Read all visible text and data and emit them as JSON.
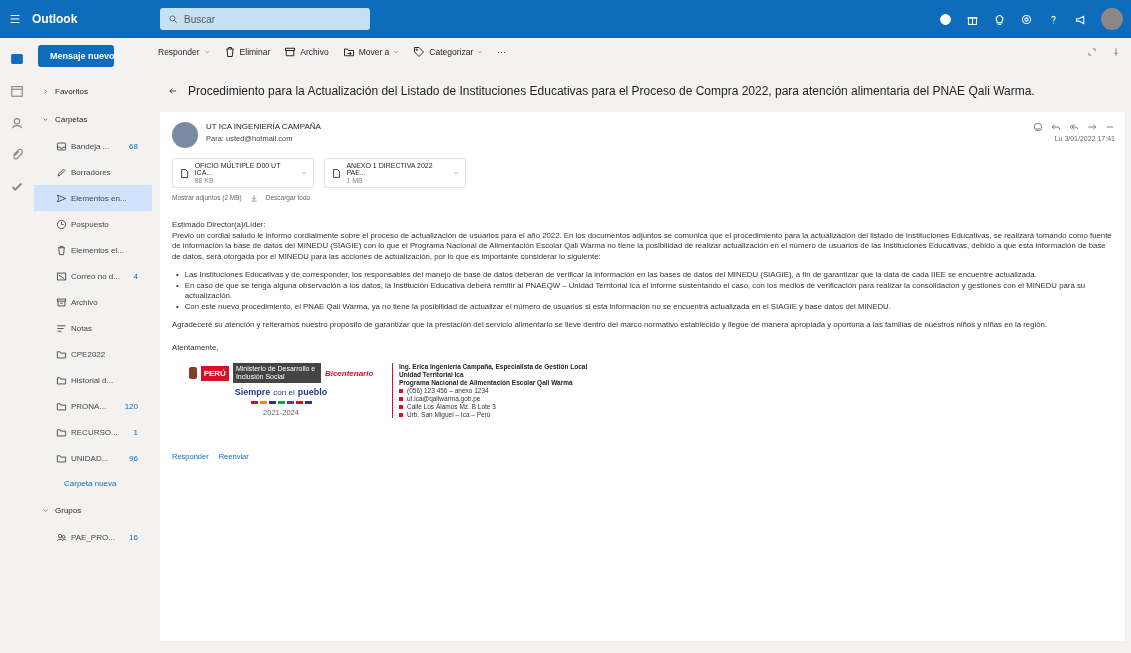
{
  "app": {
    "name": "Outlook",
    "search_placeholder": "Buscar"
  },
  "rail": [
    {
      "kind": "mail",
      "selected": true
    },
    {
      "kind": "calendar",
      "selected": false
    },
    {
      "kind": "people",
      "selected": false
    },
    {
      "kind": "clip",
      "selected": false
    },
    {
      "kind": "todo",
      "selected": false
    }
  ],
  "toolbar": {
    "new_message": "Mensaje nuevo",
    "actions": [
      {
        "kind": "reply",
        "label": "Responder",
        "has_menu": true
      },
      {
        "kind": "delete",
        "label": "Eliminar",
        "has_menu": false
      },
      {
        "kind": "archive",
        "label": "Archivo",
        "has_menu": false
      },
      {
        "kind": "move",
        "label": "Mover a",
        "has_menu": true
      },
      {
        "kind": "tag",
        "label": "Categorizar",
        "has_menu": true
      }
    ],
    "more": "···"
  },
  "folders": [
    {
      "kind": "section",
      "label": "Favoritos",
      "expanded": false
    },
    {
      "kind": "section",
      "label": "Carpetas",
      "expanded": true
    },
    {
      "kind": "inbox",
      "label": "Bandeja ...",
      "count": "68",
      "selected": false
    },
    {
      "kind": "draft",
      "label": "Borradores",
      "selected": false
    },
    {
      "kind": "sent",
      "label": "Elementos en...",
      "selected": true
    },
    {
      "kind": "clock",
      "label": "Pospuesto",
      "selected": false
    },
    {
      "kind": "trash",
      "label": "Elementos el...",
      "selected": false
    },
    {
      "kind": "junk",
      "label": "Correo no d...",
      "count": "4",
      "selected": false
    },
    {
      "kind": "archive",
      "label": "Archivo",
      "selected": false
    },
    {
      "kind": "note",
      "label": "Notas",
      "selected": false
    },
    {
      "kind": "folder",
      "label": "CPE2022",
      "selected": false
    },
    {
      "kind": "folder",
      "label": "Historial d...",
      "selected": false
    },
    {
      "kind": "folder",
      "label": "PRONA...",
      "count": "120",
      "selected": false
    },
    {
      "kind": "folder",
      "label": "RECURSO...",
      "count": "1",
      "selected": false
    },
    {
      "kind": "folder",
      "label": "UNIDAD...",
      "count": "96",
      "selected": false
    },
    {
      "kind": "link",
      "label": "Carpeta nueva"
    },
    {
      "kind": "section",
      "label": "Grupos",
      "expanded": true
    },
    {
      "kind": "group",
      "label": "PAE_PRO...",
      "count": "16",
      "selected": false
    }
  ],
  "message": {
    "subject": "Procedimiento para la Actualización del Listado de Instituciones Educativas para el Proceso de Compra 2022, para atención alimentaria del PNAE Qali Warma.",
    "sender": "UT ICA INGENIERÍA CAMPAÑA",
    "to": "Para: usted@hotmail.com",
    "date": "Lu 3/01/2022 17:41",
    "attachments": [
      {
        "name": "OFICIO MÚLTIPLE D00 UT ICA...",
        "size": "88 KB"
      },
      {
        "name": "ANEXO 1 DIRECTIVA 2022 PAE...",
        "size": "1 MB"
      }
    ],
    "attachments_summary": "Mostrar adjuntos (2 MB)",
    "download": "Descargar todo",
    "greeting": "Estimado Director(a)/Líder:",
    "intro": "Previo un cordial saludo le informo cordialmente sobre el proceso de actualización de usuarios para el año 2022. En los documentos adjuntos se comunica que el procedimiento para la actualización del listado de Instituciones Educativas, se realizará tomando como fuente de información la base de datos del MINEDU (SIAGIE) con lo que el Programa Nacional de Alimentación Escolar Qali Warma no tiene la posibilidad de realizar actualización en el número de usuarios de las Instituciones Educativas, debido a que esta información de base de datos, será otorgada por el MINEDU para las acciones de actualización, por lo que es importante considerar lo siguiente:",
    "bullets": [
      {
        "marker": "•",
        "text": "Las Instituciones Educativas y de corresponder, los responsables del manejo de base de datos deberán de verificar la información en las bases de datos del MINEDU (SIAGIE), a fin de garantizar que la data de cada IIEE se encuentre actualizada."
      },
      {
        "marker": "•",
        "text": "En caso de que se tenga alguna observación a los datos, la Institución Educativa deberá remitir al PNAEQW – Unidad Territorial Ica el informe sustentando el caso, con los medios de verificación para realizar la consolidación y gestiones con el MINEDU para su actualización."
      },
      {
        "marker": "•",
        "text": "Con este nuevo procedimiento, el PNAE Qali Warma, ya no tiene la posibilidad de actualizar el número de usuarios si esta información no se encuentra actualizada en el SIAGIE y base datos del MINEDU."
      }
    ],
    "closing": "Agradeceré su atención y reiteramos nuestro propósito de garantizar que la prestación del servicio alimentario se lleve dentro del marco normativo establecido y llegue de manera apropiada y oportuna a las familias de nuestros niños y niñas en la región.",
    "signoff": "Atentamente,",
    "logo": {
      "ministry": "Ministerio de Desarrollo e Inclusión Social",
      "country": "PERÚ",
      "bicentennial": "Bicentenario",
      "slogan_a": "Siempre",
      "slogan_b": "con el",
      "slogan_c": "pueblo",
      "caption": "2021-2024"
    },
    "signature": {
      "heading": [
        "Ing. Erica Ingeniería Campaña, Especialista de Gestión Local",
        "Unidad Territorial Ica",
        "Programa Nacional de Alimentación Escolar Qali Warma"
      ],
      "contacts": [
        "(056) 123 456 – anexo 1234",
        "ut.ica@qaliwarma.gob.pe",
        "Calle Los Álamos Mz. B Lote 3",
        "Urb. San Miguel – Ica – Perú"
      ]
    },
    "reply_links": [
      "Responder",
      "Reenviar"
    ]
  }
}
